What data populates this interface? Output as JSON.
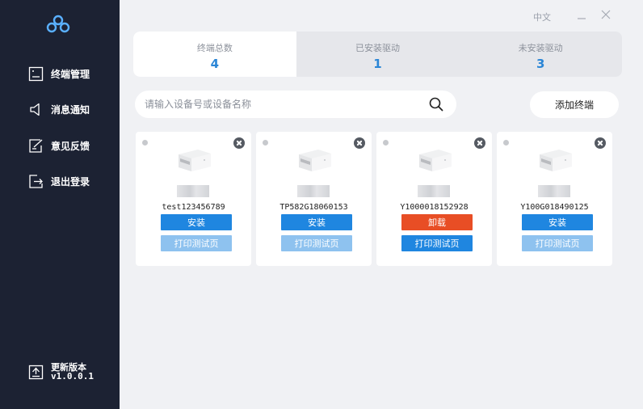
{
  "window": {
    "language_label": "中文",
    "minimize_glyph": "_",
    "close_glyph": "✕"
  },
  "sidebar": {
    "items": [
      {
        "label": "终端管理",
        "icon": "terminal-icon"
      },
      {
        "label": "消息通知",
        "icon": "speaker-icon"
      },
      {
        "label": "意见反馈",
        "icon": "feedback-icon"
      },
      {
        "label": "退出登录",
        "icon": "logout-icon"
      }
    ],
    "update": {
      "label": "更新版本",
      "version": "v1.0.0.1",
      "icon": "upload-icon"
    }
  },
  "tabs": [
    {
      "label": "终端总数",
      "count": "4"
    },
    {
      "label": "已安装驱动",
      "count": "1"
    },
    {
      "label": "未安装驱动",
      "count": "3"
    }
  ],
  "search": {
    "placeholder": "请输入设备号或设备名称"
  },
  "add_button": "添加终端",
  "cards": [
    {
      "serial": "test123456789",
      "action": "安装",
      "action_type": "install",
      "test_label": "打印测试页",
      "test_enabled": false
    },
    {
      "serial": "TP582G18060153",
      "action": "安装",
      "action_type": "install",
      "test_label": "打印测试页",
      "test_enabled": false
    },
    {
      "serial": "Y1000018152928",
      "action": "卸载",
      "action_type": "uninstall",
      "test_label": "打印测试页",
      "test_enabled": true
    },
    {
      "serial": "Y100G018490125",
      "action": "安装",
      "action_type": "install",
      "test_label": "打印测试页",
      "test_enabled": false
    }
  ],
  "colors": {
    "sidebar_bg": "#1c2233",
    "accent_blue": "#1f86e0",
    "uninstall_red": "#e84e25",
    "disabled_blue": "#8ec2ef",
    "count_blue": "#2b86d6"
  }
}
